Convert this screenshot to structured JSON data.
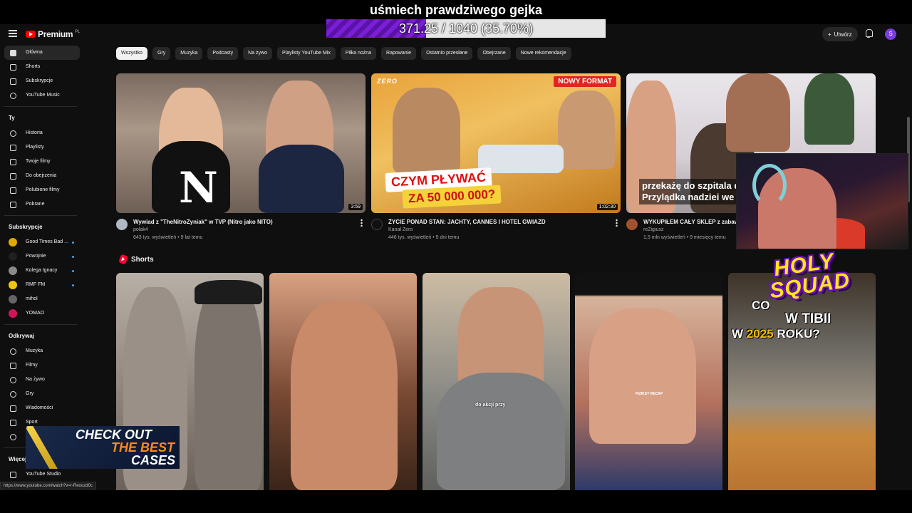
{
  "stream": {
    "title": "uśmiech prawdziwego gejka",
    "goal_text": "371.25 / 1040 (35.70%)",
    "goal_progress": 0.357
  },
  "masthead": {
    "logo_text": "Premium",
    "logo_region": "PL",
    "create_label": "Utwórz",
    "avatar_letter": "S"
  },
  "sidebar": {
    "main": [
      {
        "label": "Główna",
        "icon": "home-icon",
        "active": true
      },
      {
        "label": "Shorts",
        "icon": "shorts-icon"
      },
      {
        "label": "Subskrypcje",
        "icon": "subscriptions-icon"
      },
      {
        "label": "YouTube Music",
        "icon": "music-icon"
      }
    ],
    "you_heading": "Ty",
    "you": [
      {
        "label": "Historia",
        "icon": "history-icon"
      },
      {
        "label": "Playlisty",
        "icon": "playlists-icon"
      },
      {
        "label": "Twoje filmy",
        "icon": "your-videos-icon"
      },
      {
        "label": "Do obejrzenia",
        "icon": "watch-later-icon"
      },
      {
        "label": "Polubione filmy",
        "icon": "liked-icon"
      },
      {
        "label": "Pobrane",
        "icon": "download-icon"
      }
    ],
    "subs_heading": "Subskrypcje",
    "subs": [
      {
        "label": "Good Times Bad ...",
        "color": "#e0a800",
        "dot": true
      },
      {
        "label": "Powojnie",
        "color": "#202020",
        "dot": true
      },
      {
        "label": "Kolega Ignacy",
        "color": "#8a8a8a",
        "dot": true
      },
      {
        "label": "RMF FM",
        "color": "#f1c40f",
        "dot": true
      },
      {
        "label": "mihol",
        "color": "#666666",
        "dot": false
      },
      {
        "label": "YOMAO",
        "color": "#d4145a",
        "dot": false
      }
    ],
    "explore_heading": "Odkrywaj",
    "explore": [
      {
        "label": "Muzyka",
        "icon": "music-note-icon"
      },
      {
        "label": "Filmy",
        "icon": "film-icon"
      },
      {
        "label": "Na żywo",
        "icon": "live-icon"
      },
      {
        "label": "Gry",
        "icon": "gaming-icon"
      },
      {
        "label": "Wiadomości",
        "icon": "news-icon"
      },
      {
        "label": "Sport",
        "icon": "trophy-icon"
      },
      {
        "label": "",
        "icon": "podcast-icon"
      }
    ],
    "more_heading": "Więcej",
    "more": [
      {
        "label": "YouTube Studio",
        "icon": "youtube-studio-icon"
      }
    ]
  },
  "chips": [
    "Wszystko",
    "Gry",
    "Muzyka",
    "Podcasty",
    "Na żywo",
    "Playlisty YouTube Mix",
    "Piłka nożna",
    "Rapowanie",
    "Ostatnio przesłane",
    "Obejrzane",
    "Nowe rekomendacje"
  ],
  "videos": [
    {
      "title": "Wywiad z \"TheNitroZyniak\" w TVP (Nitro jako NITO)",
      "channel": "polak4",
      "stats": "643 tys. wyświetleń • 9 lat temu",
      "duration": "3:59",
      "avatar_color": "#b0b8c4",
      "thumb_letter": "N"
    },
    {
      "title": "ŻYCIE PONAD STAN: JACHTY, CANNES I HOTEL GWIAZD",
      "channel": "Kanał Zero",
      "stats": "446 tys. wyświetleń • 5 dni temu",
      "duration": "1:02:30",
      "avatar_color": "#111111",
      "badge": "NOWY FORMAT",
      "brand": "ZERO",
      "headline": "CZYM PŁYWAĆ",
      "subline": "ZA 50 000 000?"
    },
    {
      "title": "WYKUPIŁEM CAŁY SKLEP z zabawka",
      "channel": "reZigiusz",
      "stats": "1,5 mln wyświetleń • 9 miesięcy temu",
      "avatar_color": "#a0522d",
      "caption": "przekażę do szpitala dl Przylądka nadziei we W"
    }
  ],
  "shorts": {
    "heading": "Shorts",
    "items": [
      {
        "caption": ""
      },
      {
        "caption": ""
      },
      {
        "caption": "do akcji przy"
      },
      {
        "caption": "PIZIKSY RECAP"
      },
      {
        "line1": "CO",
        "line2": "W TIBII",
        "line3_prefix": "W ",
        "line3_year": "2025",
        "line3_suffix": " ROKU?"
      }
    ]
  },
  "overlays": {
    "holy_line1": "HOLY",
    "holy_line2": "SQUAD",
    "promo_l1": "CHECK OUT",
    "promo_l2": "THE BEST",
    "promo_l3": "CASES"
  },
  "status_url": "https://www.youtube.com/watch?v=r-Reoozd0c"
}
